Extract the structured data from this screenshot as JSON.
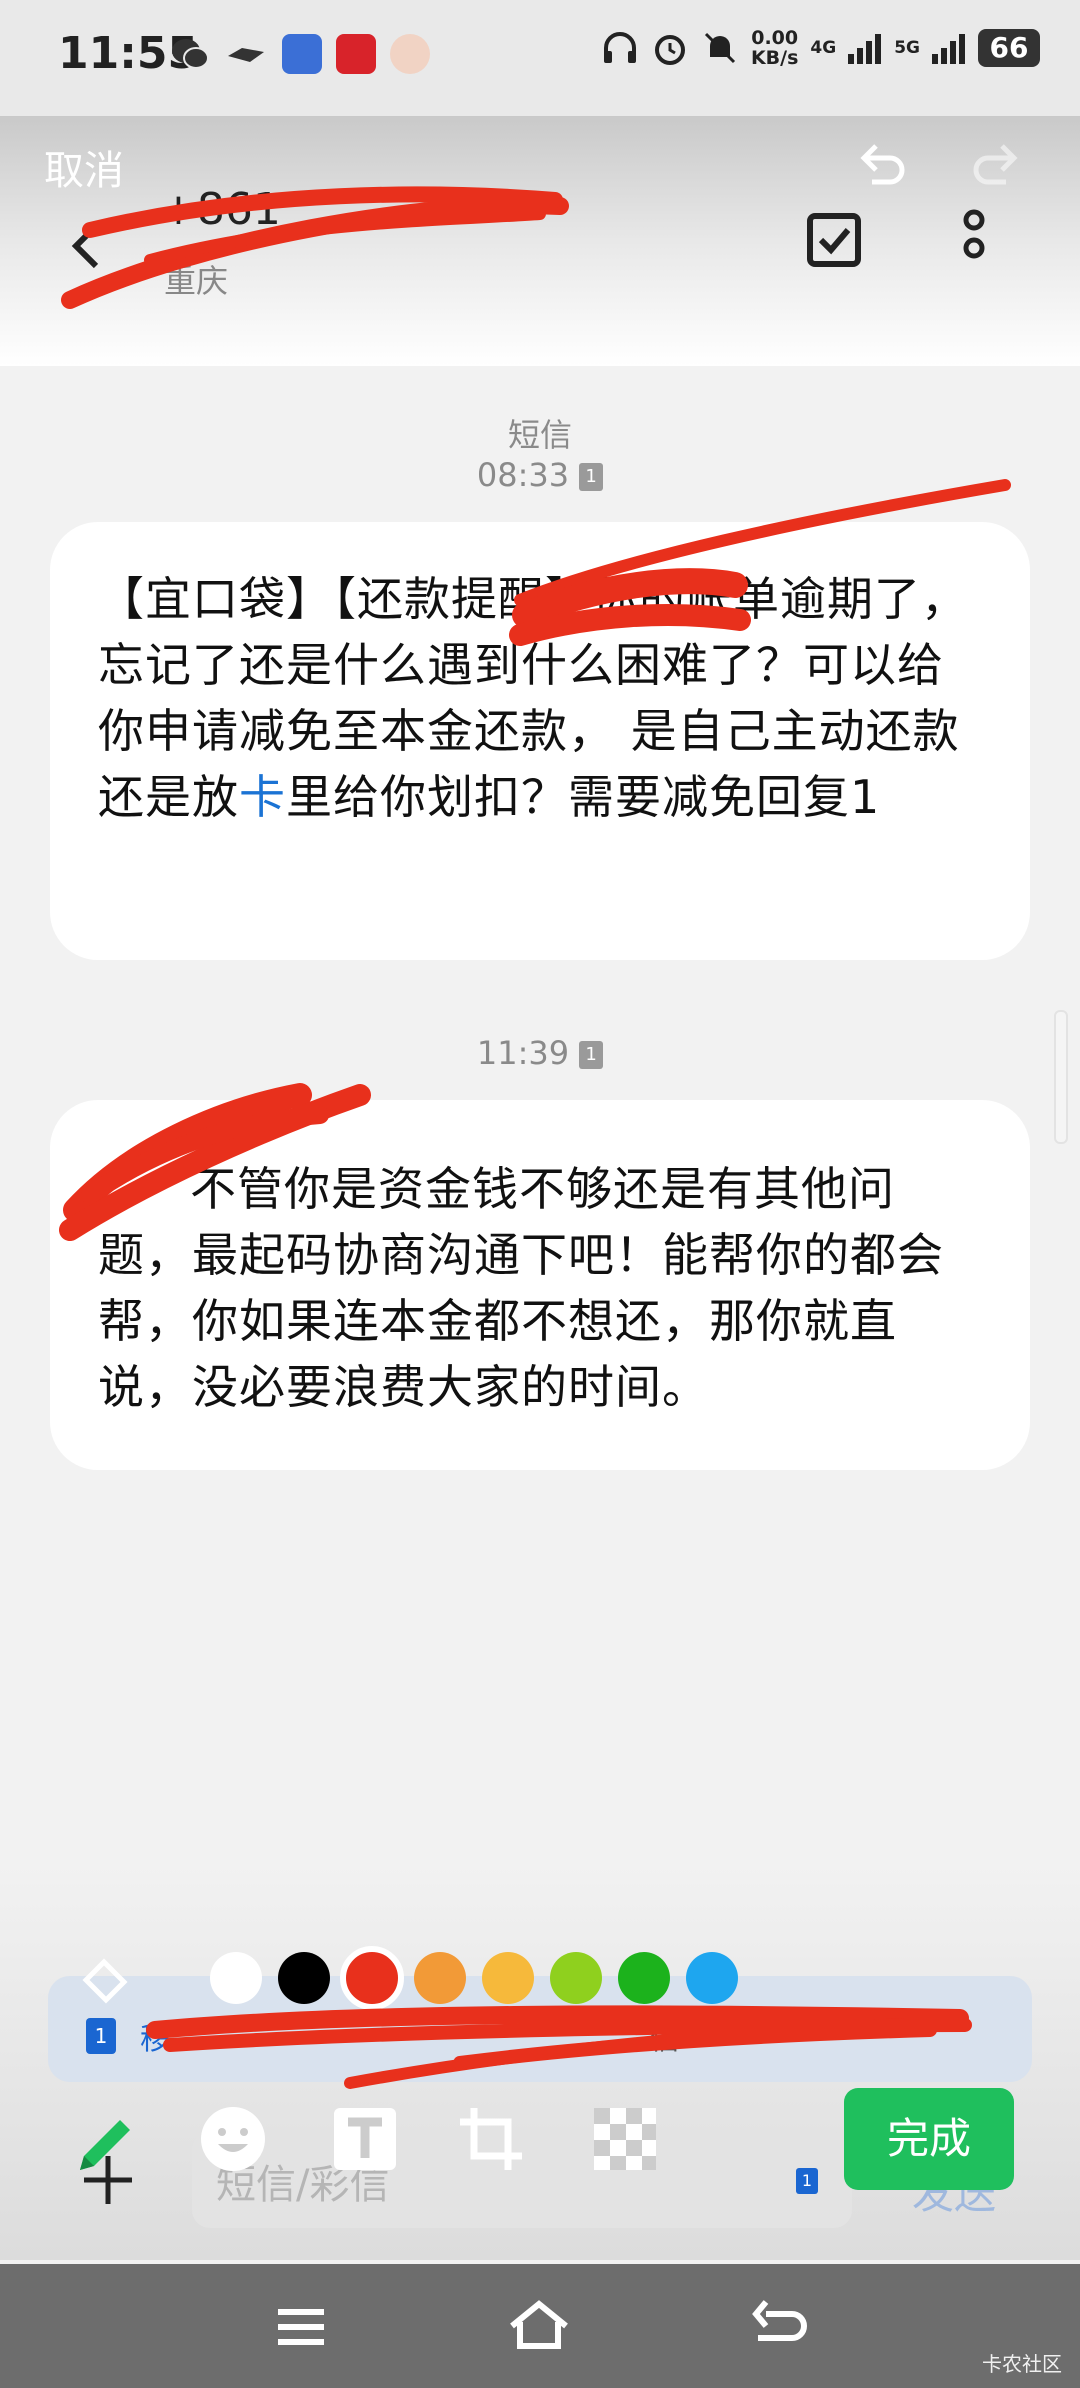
{
  "status_bar": {
    "time": "11:55",
    "speed_value": "0.00",
    "speed_unit": "KB/s",
    "net1": "4G",
    "net2": "5G",
    "battery": "66"
  },
  "header": {
    "cancel_label": "取消",
    "phone_number": "+861",
    "location": "重庆"
  },
  "conversation": {
    "channel_label": "短信",
    "messages": [
      {
        "time": "08:33",
        "sim": "1",
        "text_part1": "【宜口袋】【还款提醒】",
        "text_part2": "你的账单逾期了，忘记了还是什么遇到什么困难了？可以给你申请减免至本金还款， 是自己主动还款还是放",
        "text_link": "卡",
        "text_part3": "里给你划扣？需要减免回复1"
      },
      {
        "time": "11:39",
        "sim": "1",
        "text": "不管你是资金钱不够还是有其他问题，最起码协商沟通下吧！能帮你的都会帮，你如果连本金都不想还，那你就直说，没必要浪费大家的时间。"
      }
    ]
  },
  "compose": {
    "sim_badge": "1",
    "sim_label": "移",
    "sim_label2": "信",
    "input_placeholder": "短信/彩信",
    "input_sim": "1",
    "send_label": "发送"
  },
  "editor": {
    "colors": [
      "#ffffff",
      "#000000",
      "#e8301c",
      "#f29a37",
      "#f6b93b",
      "#8fd01e",
      "#1cb21c",
      "#1ea6ef"
    ],
    "selected_color": "#e8301c",
    "done_label": "完成",
    "accent": "#1fbf5d"
  },
  "watermark": "卡农社区"
}
